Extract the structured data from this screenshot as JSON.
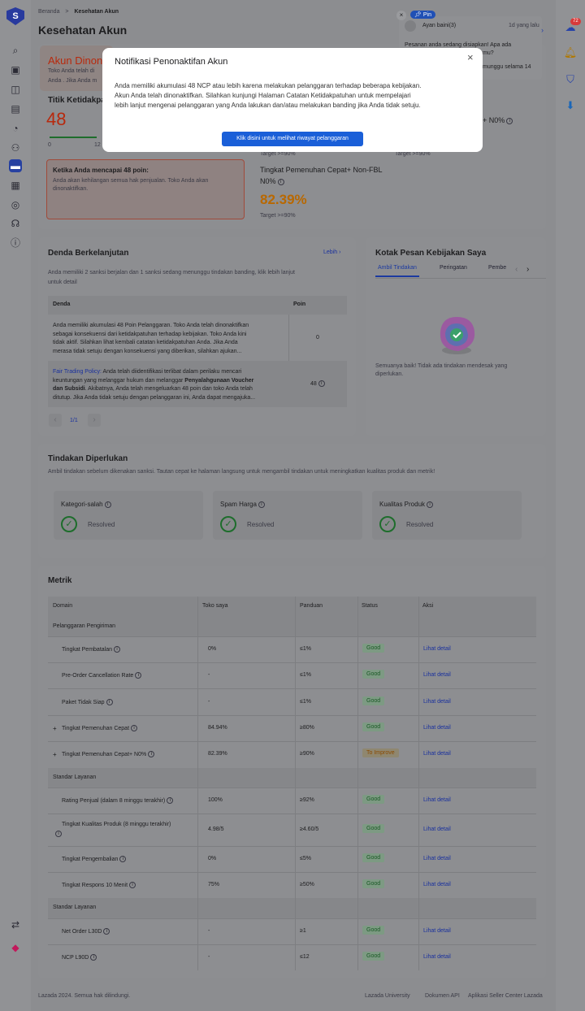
{
  "app": {
    "logo_letter": "S",
    "accent": "#1a5fd8"
  },
  "breadcrumb": {
    "home": "Beranda",
    "sep": ">",
    "current": "Kesehatan Akun"
  },
  "page_title": "Kesehatan Akun",
  "icons_left": [
    "search-icon",
    "store-icon",
    "shopping-bag-icon",
    "ads-icon",
    "chart-icon",
    "users-icon",
    "health-icon",
    "finance-icon",
    "growth-icon",
    "headset-icon",
    "help-icon",
    "translate-icon",
    "lazada-icon"
  ],
  "icons_right": [
    "chat-icon",
    "bell-icon",
    "shield-icon",
    "download-icon"
  ],
  "notif_badge": "72",
  "chat_popup": {
    "close": "×",
    "pin": "Pin",
    "name": "Ayan baini(3)",
    "time": "1d yang lalu",
    "msg1": "Pesanan anda sedang disiapkan! Apa ada",
    "msg2": "mu?",
    "msg3": "munggu selama 14"
  },
  "status_card": {
    "title": "Akun Dinona",
    "line1": "Toko Anda telah di",
    "line2": "Anda . Jika Anda m"
  },
  "ncp": {
    "label": "Titik Ketidakpa",
    "value": "48",
    "scale0": "0",
    "scale12": "12"
  },
  "warning": {
    "title": "Ketika Anda mencapai 48 poin:",
    "body": "Anda akan kehilangan semua hak penjualan. Toko Anda akan dinonaktifkan."
  },
  "metrics_top": {
    "target1": "Target >=90%",
    "target2": "Target >=90%",
    "right_frag": "+ N0%",
    "fbl_label1": "Tingkat Pemenuhan Cepat+ Non-FBL",
    "fbl_label2": "N0%",
    "fbl_value": "82.39%",
    "fbl_target": "Target >=90%"
  },
  "modal": {
    "title": "Notifikasi Penonaktifan Akun",
    "close": "×",
    "body1": "Anda memiliki akumulasi 48 NCP atau lebih karena melakukan pelanggaran terhadap beberapa kebijakan.",
    "body2": "Akun Anda telah dinonaktifkan. Silahkan kunjungi Halaman Catatan Ketidakpatuhan untuk mempelajari",
    "body3": "lebih lanjut mengenai pelanggaran yang Anda lakukan dan/atau melakukan banding jika Anda tidak setuju.",
    "button": "Klik disini untuk melihat riwayat pelanggaran"
  },
  "penalty": {
    "title": "Denda Berkelanjutan",
    "more": "Lebih",
    "desc1": "Anda memiliki 2 sanksi berjalan dan 1 sanksi sedang menunggu tindakan banding, klik lebih lanjut",
    "desc2": "untuk detail",
    "col1": "Denda",
    "col2": "Poin",
    "row1": [
      "Anda memiliki akumulasi 48 Poin Pelanggaran. Toko Anda telah dinonaktifkan",
      "sebagai konsekuensi dari ketidakpatuhan terhadap kebijakan. Toko Anda kini",
      "tidak aktif. Silahkan lihat kembali catatan ketidakpatuhan Anda. Jika Anda",
      "merasa tidak setuju dengan konsekuensi yang diberikan, silahkan ajukan..."
    ],
    "row1_pts": "0",
    "row2_link": "Fair Trading Policy:",
    "row2_l1": " Anda telah diidentifikasi terlibat dalam perilaku mencari",
    "row2_l2a": "keuntungan yang melanggar hukum dan melanggar ",
    "row2_l2b": "Penyalahgunaan Voucher",
    "row2_l3a": "dan Subsidi",
    "row2_l3b": ". Akibatnya, Anda telah mengeluarkan 48 poin dan toko Anda telah",
    "row2_l4": "ditutup. Jika Anda tidak setuju dengan pelanggaran ini, Anda dapat mengajuka...",
    "row2_pts": "48",
    "pager": "1/1",
    "prev": "‹",
    "next": "›"
  },
  "inbox": {
    "title": "Kotak Pesan Kebijakan Saya",
    "tabs": [
      "Ambil Tindakan",
      "Peringatan",
      "Pembe"
    ],
    "empty1": "Semuanya baik! Tidak ada tindakan mendesak yang",
    "empty2": "diperlukan."
  },
  "actions": {
    "title": "Tindakan Diperlukan",
    "desc": "Ambil tindakan sebelum dikenakan sanksi. Tautan cepat ke halaman langsung untuk mengambil tindakan untuk meningkatkan kualitas produk dan metrik!",
    "items": [
      {
        "label": "Kategori-salah",
        "status": "Resolved"
      },
      {
        "label": "Spam Harga",
        "status": "Resolved"
      },
      {
        "label": "Kualitas Produk",
        "status": "Resolved"
      }
    ]
  },
  "metrik": {
    "title": "Metrik",
    "headers": [
      "Domain",
      "Toko saya",
      "Panduan",
      "Status",
      "Aksi"
    ],
    "groups": [
      "Pelanggaran Pengiriman",
      "Standar Layanan",
      "Standar Layanan"
    ],
    "rows": [
      {
        "name": "Tingkat Pembatalan",
        "mine": "0%",
        "guide": "≤1%",
        "status": "Good",
        "action": "Lihat detail"
      },
      {
        "name": "Pre-Order Cancellation Rate",
        "mine": "-",
        "guide": "≤1%",
        "status": "Good",
        "action": "Lihat detail"
      },
      {
        "name": "Paket Tidak Siap",
        "mine": "-",
        "guide": "≤1%",
        "status": "Good",
        "action": "Lihat detail"
      },
      {
        "name": "Tingkat Pemenuhan Cepat",
        "mine": "84.94%",
        "guide": "≥80%",
        "status": "Good",
        "action": "Lihat detail"
      },
      {
        "name": "Tingkat Pemenuhan Cepat+ N0%",
        "mine": "82.39%",
        "guide": "≥90%",
        "status": "To Improve",
        "action": "Lihat detail"
      },
      {
        "name": "Rating Penjual (dalam 8 minggu terakhir)",
        "mine": "100%",
        "guide": "≥92%",
        "status": "Good",
        "action": "Lihat detail"
      },
      {
        "name": "Tingkat Kualitas Produk (8 minggu terakhir)",
        "mine": "4.98/5",
        "guide": "≥4.60/5",
        "status": "Good",
        "action": "Lihat detail"
      },
      {
        "name": "Tingkat Pengembalian",
        "mine": "0%",
        "guide": "≤5%",
        "status": "Good",
        "action": "Lihat detail"
      },
      {
        "name": "Tingkat Respons 10 Menit",
        "mine": "75%",
        "guide": "≥50%",
        "status": "Good",
        "action": "Lihat detail"
      },
      {
        "name": "Net Order L30D",
        "mine": "-",
        "guide": "≥1",
        "status": "Good",
        "action": "Lihat detail"
      },
      {
        "name": "NCP L90D",
        "mine": "-",
        "guide": "≤12",
        "status": "Good",
        "action": "Lihat detail"
      }
    ]
  },
  "footer": {
    "copy": "Lazada 2024. Semua hak dilindungi.",
    "links": [
      "Lazada University",
      "Dokumen API",
      "Aplikasi Seller Center Lazada"
    ]
  }
}
